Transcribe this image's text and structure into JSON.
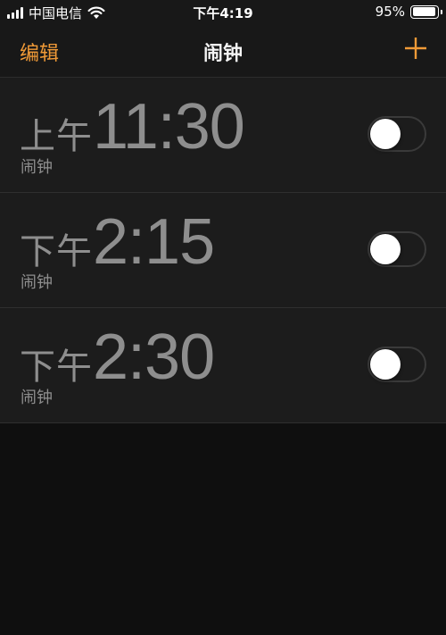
{
  "status_bar": {
    "carrier": "中国电信",
    "time": "下午4:19",
    "battery_percent_text": "95%",
    "battery_level": 0.95
  },
  "nav": {
    "edit_label": "编辑",
    "title": "闹钟",
    "add_icon": "plus-icon"
  },
  "colors": {
    "accent": "#f09a37",
    "background": "#0f0f0f",
    "row_background": "#1c1c1c",
    "inactive_text": "#8e8e8e"
  },
  "alarms": [
    {
      "ampm": "上午",
      "time": "11:30",
      "label": "闹钟",
      "enabled": false
    },
    {
      "ampm": "下午",
      "time": "2:15",
      "label": "闹钟",
      "enabled": false
    },
    {
      "ampm": "下午",
      "time": "2:30",
      "label": "闹钟",
      "enabled": false
    }
  ]
}
